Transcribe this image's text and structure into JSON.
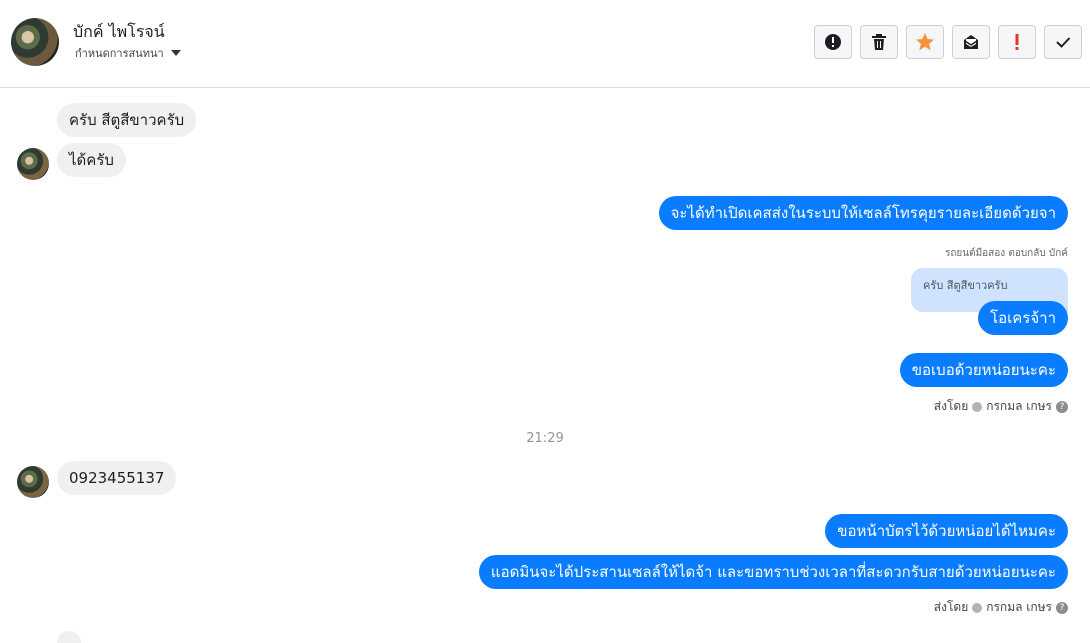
{
  "header": {
    "name": "บักค์ ไพโรจน์",
    "assign_label": "กำหนดการสนทนา",
    "toolbar": [
      {
        "icon": "alert-circle-icon"
      },
      {
        "icon": "trash-icon"
      },
      {
        "icon": "star-icon"
      },
      {
        "icon": "mark-unread-icon"
      },
      {
        "icon": "exclamation-icon"
      },
      {
        "icon": "check-icon"
      }
    ]
  },
  "messages": {
    "in1": "ครับ สีตูสีขาวครับ",
    "in2": "ได้ครับ",
    "out1": "จะได้ทำเปิดเคสส่งในระบบให้เซลล์โทรคุยรายละเอียดด้วยจา",
    "reply_note": "รถยนต์มือสอง ตอบกลับ บักค์",
    "quoted": "ครับ สีตูสีขาวครับ",
    "out2": "โอเครจ้าา",
    "out3": "ขอเบอด้วยหน่อยนะคะ",
    "sent_by_label_1": "ส่งโดย",
    "sent_by_name_1": "กรกมล เกษร",
    "time": "21:29",
    "in3": "0923455137",
    "out4": "ขอหน้าบัตรไว้ด้วยหน่อยได้ไหมคะ",
    "out5": "แอดมินจะได้ประสานเซลล์ให้ไดจ้า และขอทราบช่วงเวลาที่สะดวกรับสายด้วยหน่อยนะคะ",
    "sent_by_label_2": "ส่งโดย",
    "sent_by_name_2": "กรกมล เกษร"
  },
  "colors": {
    "outgoing": "#0a7cff",
    "incoming": "#f0f0f0",
    "star": "#f7923a",
    "exclamation": "#e4372c"
  }
}
